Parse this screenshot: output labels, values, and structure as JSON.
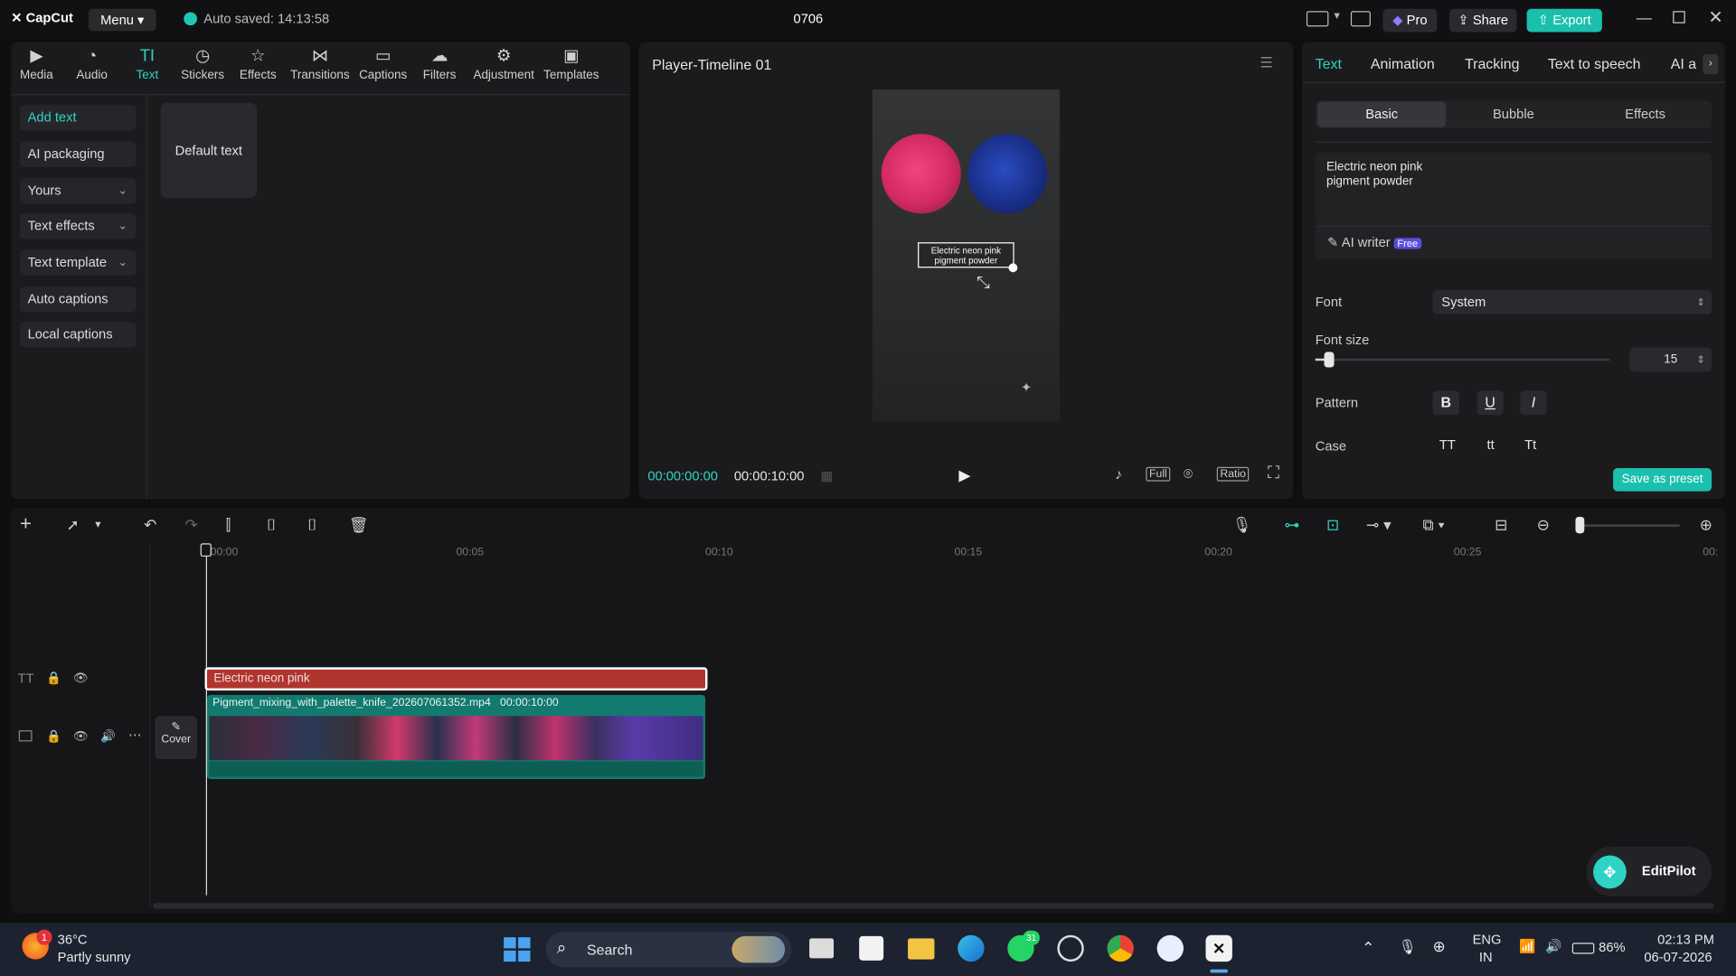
{
  "app": {
    "name": "CapCut",
    "menu_label": "Menu",
    "autosave": "Auto saved: 14:13:58",
    "project_name": "0706"
  },
  "topbar": {
    "pro_label": "Pro",
    "share_label": "Share",
    "export_label": "Export"
  },
  "tools": [
    {
      "label": "Media",
      "icon": "media-icon"
    },
    {
      "label": "Audio",
      "icon": "audio-icon"
    },
    {
      "label": "Text",
      "icon": "text-icon",
      "active": true
    },
    {
      "label": "Stickers",
      "icon": "stickers-icon"
    },
    {
      "label": "Effects",
      "icon": "effects-icon"
    },
    {
      "label": "Transitions",
      "icon": "transitions-icon"
    },
    {
      "label": "Captions",
      "icon": "captions-icon"
    },
    {
      "label": "Filters",
      "icon": "filters-icon"
    },
    {
      "label": "Adjustment",
      "icon": "adjustment-icon"
    },
    {
      "label": "Templates",
      "icon": "templates-icon"
    }
  ],
  "sidebar": {
    "items": [
      {
        "label": "Add text"
      },
      {
        "label": "AI packaging"
      },
      {
        "label": "Yours"
      },
      {
        "label": "Text effects"
      },
      {
        "label": "Text template"
      },
      {
        "label": "Auto captions"
      },
      {
        "label": "Local captions"
      }
    ]
  },
  "library": {
    "default_text": "Default text"
  },
  "player": {
    "title": "Player-Timeline 01",
    "overlay_text_line1": "Electric neon pink",
    "overlay_text_line2": "pigment powder",
    "current_time": "00:00:00:00",
    "total_time": "00:00:10:00",
    "full_label": "Full",
    "ratio_label": "Ratio"
  },
  "inspector": {
    "tabs": [
      "Text",
      "Animation",
      "Tracking",
      "Text to speech",
      "AI a"
    ],
    "subtabs": [
      "Basic",
      "Bubble",
      "Effects"
    ],
    "text_value_line1": "Electric neon pink",
    "text_value_line2": "pigment powder",
    "ai_writer": "AI writer",
    "free_badge": "Free",
    "font_label": "Font",
    "font_value": "System",
    "font_size_label": "Font size",
    "font_size_value": "15",
    "pattern_label": "Pattern",
    "pattern_buttons": [
      "B",
      "U",
      "I"
    ],
    "case_label": "Case",
    "case_buttons": [
      "TT",
      "tt",
      "Tt"
    ],
    "save_preset": "Save as preset"
  },
  "timeline": {
    "ruler": [
      "00:00",
      "00:05",
      "00:10",
      "00:15",
      "00:20",
      "00:25",
      "00:"
    ],
    "text_clip": "Electric neon pink",
    "video_clip_name": "Pigment_mixing_with_palette_knife_202607061352.mp4",
    "video_clip_duration": "00:00:10:00",
    "cover_label": "Cover"
  },
  "editpilot": {
    "label": "EditPilot"
  },
  "taskbar": {
    "weather_temp": "36°C",
    "weather_desc": "Partly sunny",
    "weather_badge": "1",
    "search": "Search",
    "whatsapp_badge": "31",
    "lang_line1": "ENG",
    "lang_line2": "IN",
    "battery": "86%",
    "time": "02:13 PM",
    "date": "06-07-2026"
  },
  "colors": {
    "accent": "#2fd3c5",
    "export_bg": "#1bbfae",
    "text_clip": "#b0352f",
    "video_clip": "#137a6f"
  }
}
